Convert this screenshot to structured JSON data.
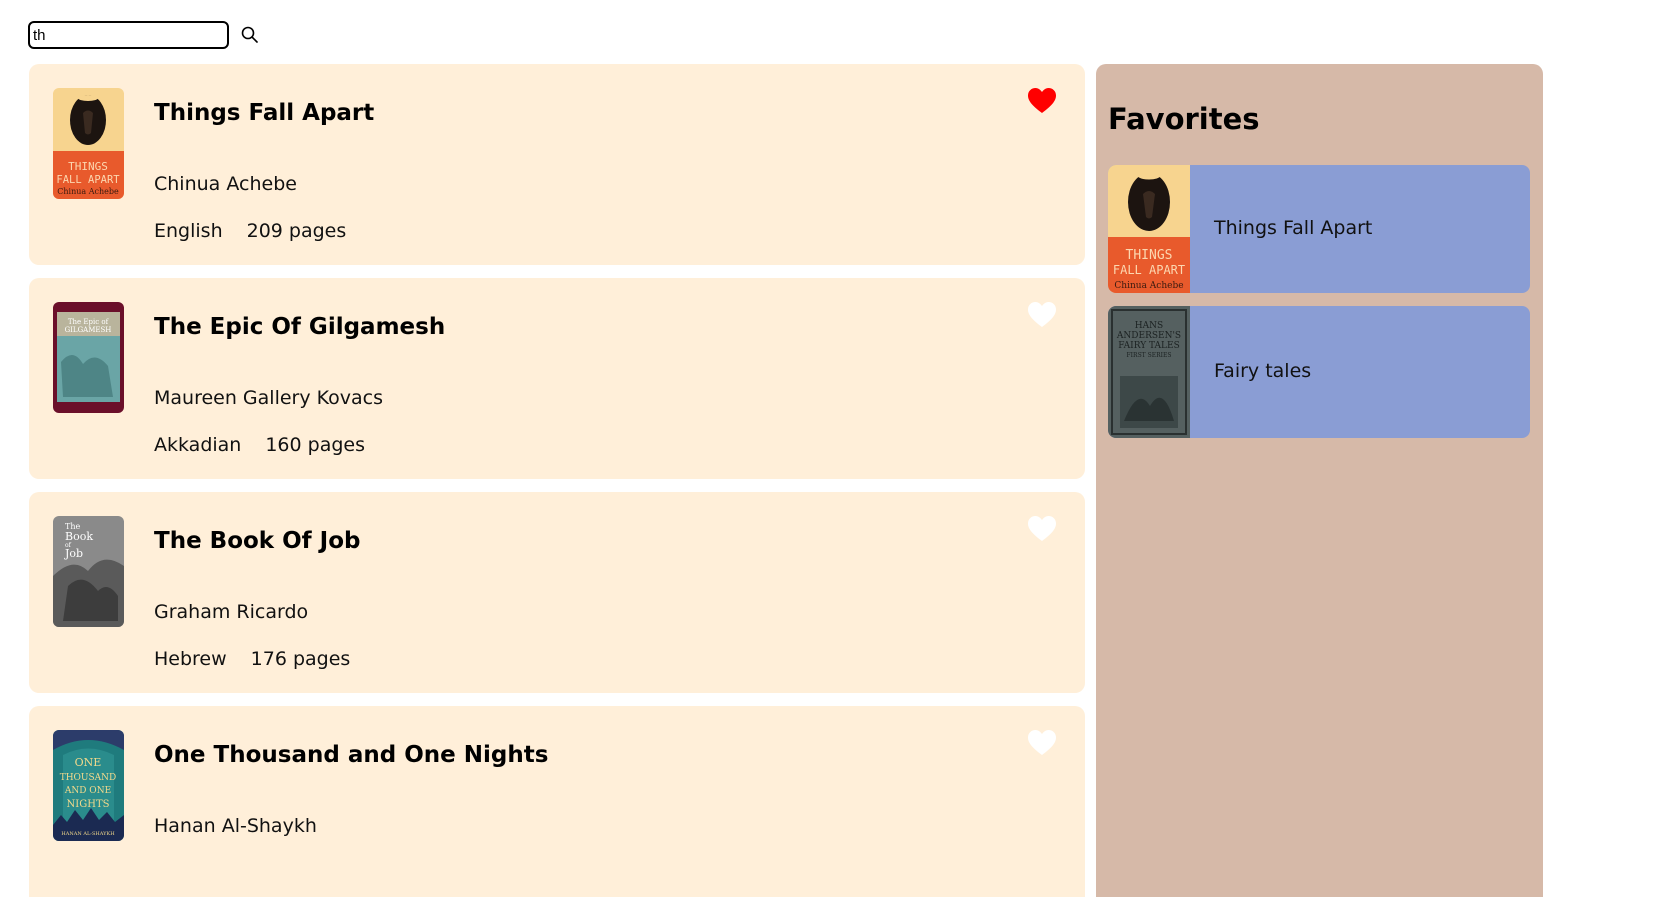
{
  "search": {
    "value": "th",
    "icon": "search-icon"
  },
  "books": [
    {
      "title": "Things Fall Apart",
      "author": "Chinua Achebe",
      "language": "English",
      "pages": "209 pages",
      "favorite": true,
      "cover_text": [
        "THINGS",
        "FALL APART",
        "Chinua Achebe"
      ]
    },
    {
      "title": "The Epic Of Gilgamesh",
      "author": "Maureen Gallery Kovacs",
      "language": "Akkadian",
      "pages": "160 pages",
      "favorite": false,
      "cover_text": [
        "The Epic of",
        "GILGAMESH"
      ]
    },
    {
      "title": "The Book Of Job",
      "author": "Graham Ricardo",
      "language": "Hebrew",
      "pages": "176 pages",
      "favorite": false,
      "cover_text": [
        "The",
        "Book",
        "of",
        "Job"
      ]
    },
    {
      "title": "One Thousand and One Nights",
      "author": "Hanan Al-Shaykh",
      "language": "",
      "pages": "",
      "favorite": false,
      "cover_text": [
        "ONE",
        "THOUSAND",
        "AND ONE",
        "NIGHTS",
        "HANAN AL-SHAYKH"
      ]
    }
  ],
  "favorites": {
    "title": "Favorites",
    "items": [
      {
        "label": "Things Fall Apart",
        "cover_text": [
          "THINGS",
          "FALL APART",
          "Chinua Achebe"
        ]
      },
      {
        "label": "Fairy tales",
        "cover_text": [
          "HANS",
          "ANDERSEN'S",
          "FAIRY TALES",
          "FIRST SERIES"
        ]
      }
    ]
  },
  "colors": {
    "card_bg": "#ffefd9",
    "panel_bg": "#d6b9a8",
    "fav_item_bg": "#8a9dd4",
    "heart_active": "#ff0000",
    "heart_inactive": "#ffffff"
  }
}
